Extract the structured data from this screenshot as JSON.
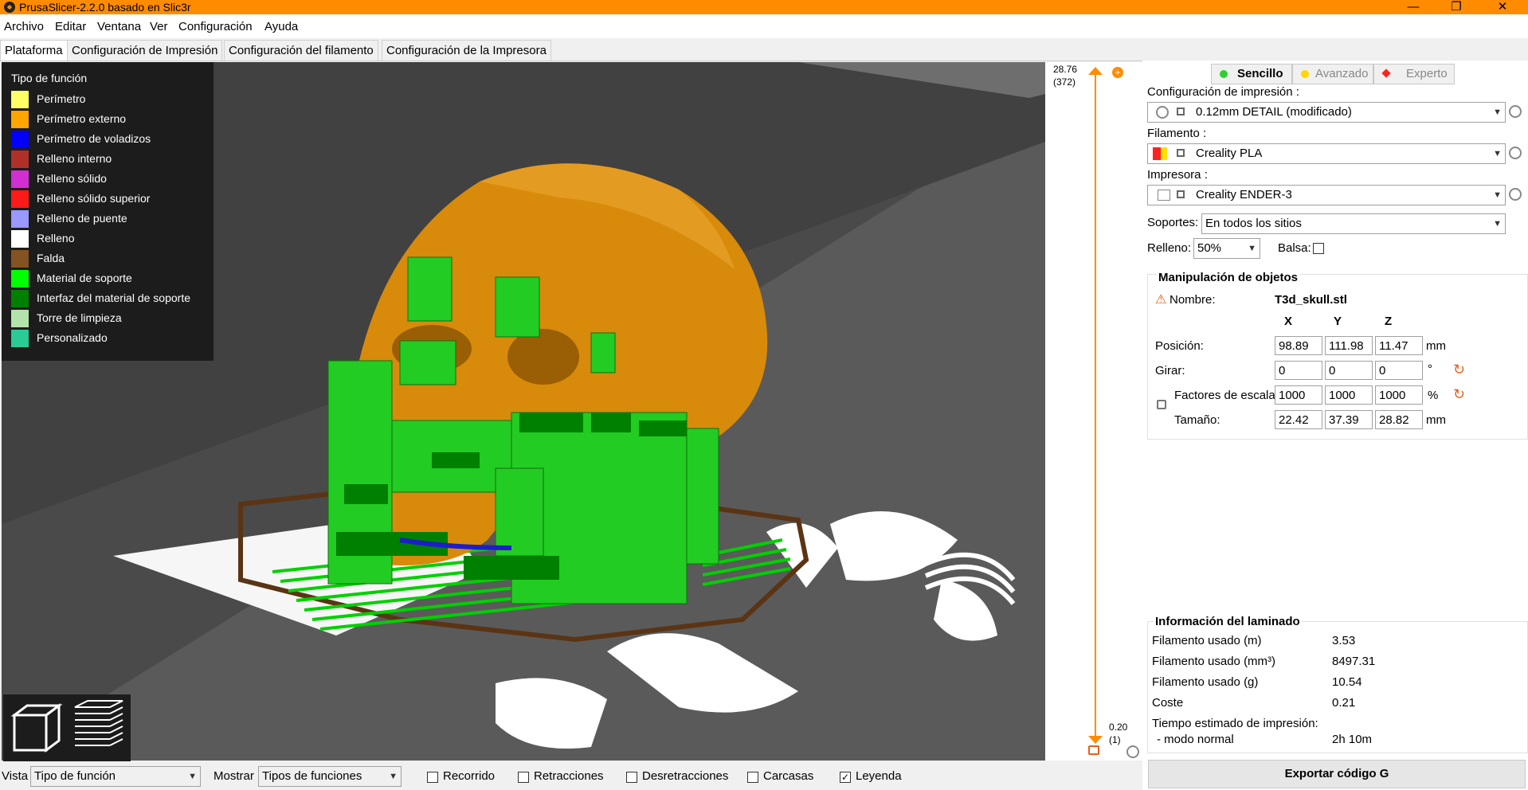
{
  "window": {
    "title": "PrusaSlicer-2.2.0 basado en Slic3r",
    "controls": [
      "—",
      "❐",
      "✕"
    ]
  },
  "menu": [
    "Archivo",
    "Editar",
    "Ventana",
    "Ver",
    "Configuración",
    "Ayuda"
  ],
  "tabs": [
    "Plataforma",
    "Configuración de Impresión",
    "Configuración del filamento",
    "Configuración de la Impresora"
  ],
  "legend": {
    "title": "Tipo de función",
    "items": [
      {
        "label": "Perímetro",
        "color": "#ffff66"
      },
      {
        "label": "Perímetro externo",
        "color": "#ffa500"
      },
      {
        "label": "Perímetro de voladizos",
        "color": "#0000ff"
      },
      {
        "label": "Relleno interno",
        "color": "#b03029"
      },
      {
        "label": "Relleno sólido",
        "color": "#d22ed2"
      },
      {
        "label": "Relleno sólido superior",
        "color": "#ff1a1a"
      },
      {
        "label": "Relleno de puente",
        "color": "#9999ff"
      },
      {
        "label": "Relleno",
        "color": "#ffffff"
      },
      {
        "label": "Falda",
        "color": "#845321"
      },
      {
        "label": "Material de soporte",
        "color": "#00ff00"
      },
      {
        "label": "Interfaz del material de soporte",
        "color": "#008000"
      },
      {
        "label": "Torre de limpieza",
        "color": "#b3e3ab"
      },
      {
        "label": "Personalizado",
        "color": "#28cc94"
      }
    ]
  },
  "layer_slider": {
    "top_value": "28.76",
    "top_layer": "(372)",
    "bottom_value": "0.20",
    "bottom_layer": "(1)"
  },
  "modes": [
    "Sencillo",
    "Avanzado",
    "Experto"
  ],
  "print_settings": {
    "label": "Configuración de impresión :",
    "value": "0.12mm DETAIL (modificado)"
  },
  "filament": {
    "label": "Filamento :",
    "value": "Creality PLA"
  },
  "printer": {
    "label": "Impresora :",
    "value": "Creality ENDER-3"
  },
  "supports": {
    "label": "Soportes:",
    "value": "En todos los sitios"
  },
  "infill": {
    "label": "Relleno:",
    "value": "50%",
    "brim_label": "Balsa:"
  },
  "object_manipulation": {
    "title": "Manipulación de objetos",
    "name_label": "Nombre:",
    "name_value": "T3d_skull.stl",
    "axes": [
      "X",
      "Y",
      "Z"
    ],
    "position_label": "Posición:",
    "position": [
      "98.89",
      "111.98",
      "11.47"
    ],
    "position_unit": "mm",
    "rotation_label": "Girar:",
    "rotation": [
      "0",
      "0",
      "0"
    ],
    "rotation_unit": "°",
    "scale_label": "Factores de escala:",
    "scale": [
      "1000",
      "1000",
      "1000"
    ],
    "scale_unit": "%",
    "size_label": "Tamaño:",
    "size": [
      "22.42",
      "37.39",
      "28.82"
    ],
    "size_unit": "mm"
  },
  "slice_info": {
    "title": "Información del laminado",
    "rows": [
      {
        "label": "Filamento usado (m)",
        "value": "3.53"
      },
      {
        "label": "Filamento usado (mm³)",
        "value": "8497.31"
      },
      {
        "label": "Filamento usado (g)",
        "value": "10.54"
      },
      {
        "label": "Coste",
        "value": "0.21"
      }
    ],
    "time_label": "Tiempo estimado de impresión:",
    "mode_label": "- modo normal",
    "mode_value": "2h 10m"
  },
  "export_button": "Exportar código G",
  "statusbar": {
    "view_label": "Vista",
    "view_value": "Tipo de función",
    "show_label": "Mostrar",
    "show_value": "Tipos de funciones",
    "checks": [
      {
        "label": "Recorrido",
        "checked": false
      },
      {
        "label": "Retracciones",
        "checked": false
      },
      {
        "label": "Desretracciones",
        "checked": false
      },
      {
        "label": "Carcasas",
        "checked": false
      },
      {
        "label": "Leyenda",
        "checked": true
      }
    ]
  },
  "colors": {
    "accent": "#ff8c00",
    "simple": "#32cd32",
    "advanced": "#ffd700",
    "expert": "#ff2222"
  }
}
